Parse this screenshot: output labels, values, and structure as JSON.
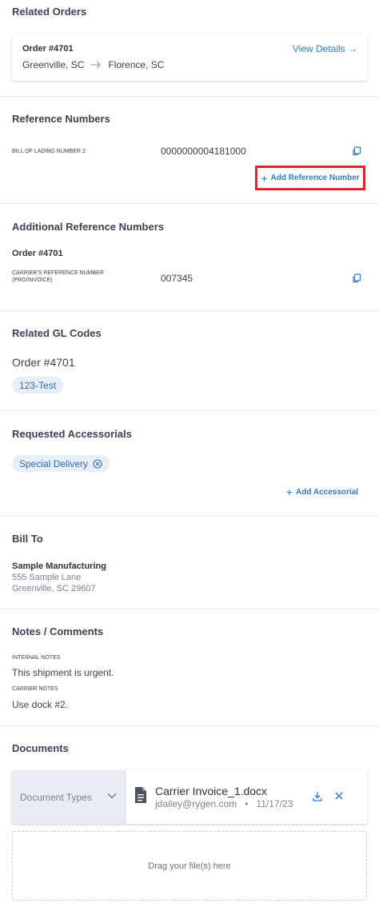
{
  "related_orders": {
    "title": "Related Orders",
    "order_number": "Order #4701",
    "origin": "Greenville, SC",
    "destination": "Florence, SC",
    "view_details": "View Details →"
  },
  "reference_numbers": {
    "title": "Reference Numbers",
    "label": "BILL OF LADING NUMBER 2",
    "value": "0000000004181000",
    "add_button": "Add Reference Number"
  },
  "additional_reference": {
    "title": "Additional Reference Numbers",
    "order_number": "Order #4701",
    "label_line1": "CARRIER'S REFERENCE NUMBER",
    "label_line2": "(PRO/INVOICE)",
    "value": "007345"
  },
  "gl_codes": {
    "title": "Related GL Codes",
    "order_number": "Order #4701",
    "chip": "123-Test"
  },
  "accessorials": {
    "title": "Requested Accessorials",
    "chip": "Special Delivery",
    "add_button": "Add Accessorial"
  },
  "bill_to": {
    "title": "Bill To",
    "name": "Sample Manufacturing",
    "address1": "555 Sample Lane",
    "address2": "Greenville, SC 29607"
  },
  "notes": {
    "title": "Notes / Comments",
    "internal_label": "INTERNAL NOTES",
    "internal_text": "This shipment is urgent.",
    "carrier_label": "CARRIER NOTES",
    "carrier_text": "Use dock #2."
  },
  "documents": {
    "title": "Documents",
    "type_placeholder": "Document Types",
    "file_name": "Carrier Invoice_1.docx",
    "file_user": "jdailey@rygen.com",
    "file_sep": "•",
    "file_date": "11/17/23",
    "dropzone": "Drag your file(s) here"
  },
  "colors": {
    "accent": "#2f7ac9",
    "highlight_border": "#e02431",
    "chip_bg": "#e8eef6"
  }
}
